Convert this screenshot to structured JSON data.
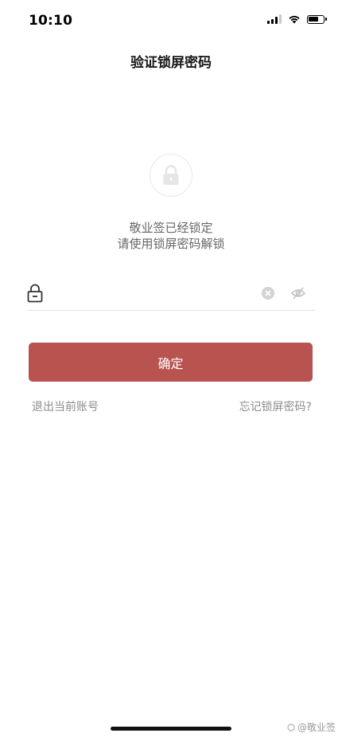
{
  "status_bar": {
    "time": "10:10"
  },
  "header": {
    "title": "验证锁屏密码"
  },
  "lock_message": {
    "line1": "敬业签已经锁定",
    "line2": "请使用锁屏密码解锁"
  },
  "password_field": {
    "value": "",
    "placeholder": ""
  },
  "confirm_button": {
    "label": "确定",
    "color": "#b9534f"
  },
  "links": {
    "logout": "退出当前账号",
    "forgot": "忘记锁屏密码?"
  },
  "watermark": {
    "text": "@敬业签"
  },
  "icons": {
    "status_signal": "cellular-signal-icon",
    "status_wifi": "wifi-icon",
    "status_battery": "battery-icon",
    "lock": "padlock-icon",
    "field_lock": "padlock-outline-icon",
    "clear": "clear-circle-icon",
    "visibility": "eye-hidden-icon"
  }
}
